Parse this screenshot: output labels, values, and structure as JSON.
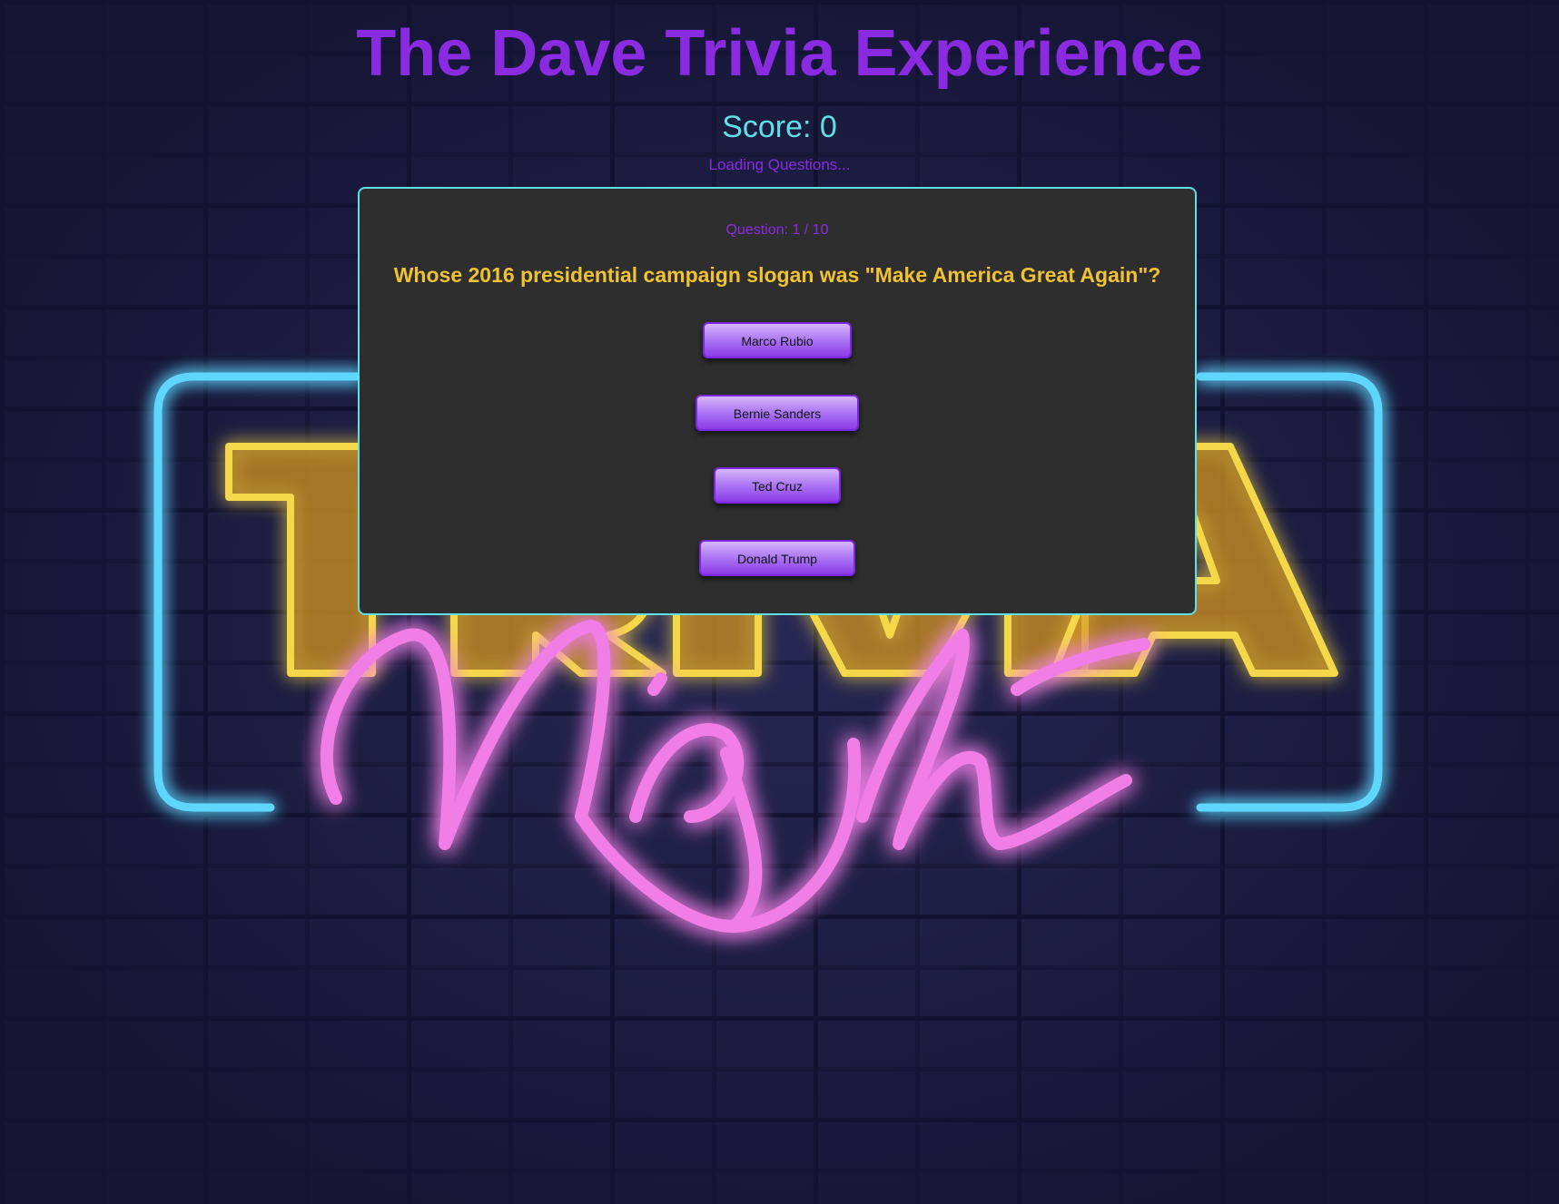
{
  "header": {
    "title": "The Dave Trivia Experience",
    "score_label": "Score: 0",
    "status": "Loading Questions..."
  },
  "quiz": {
    "counter": "Question: 1 / 10",
    "question": "Whose 2016 presidential campaign slogan was \"Make America Great Again\"?",
    "answers": [
      {
        "label": "Marco Rubio"
      },
      {
        "label": "Bernie Sanders"
      },
      {
        "label": "Ted Cruz"
      },
      {
        "label": "Donald Trump"
      }
    ]
  },
  "background": {
    "sign_text_top": "TRIVIA",
    "sign_text_script": "Night",
    "colors": {
      "brick": "#1c1d42",
      "neon_blue": "#5fd6ff",
      "neon_yellow": "#f5d84a",
      "neon_pink": "#f07ee6"
    }
  },
  "colors": {
    "title": "#8a2be2",
    "score": "#5fe0e6",
    "question": "#f0c233",
    "card_bg": "#2e2e2e",
    "card_border": "#5fe0e6",
    "button": "#a76ef2"
  }
}
